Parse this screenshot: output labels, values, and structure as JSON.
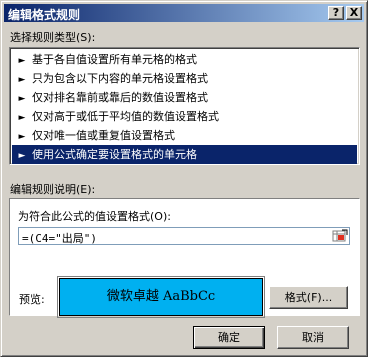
{
  "window": {
    "title": "编辑格式规则",
    "help_label": "?",
    "close_label": "X"
  },
  "rule_type": {
    "label": "选择规则类型(S):",
    "items": [
      {
        "label": "基于各自值设置所有单元格的格式"
      },
      {
        "label": "只为包含以下内容的单元格设置格式"
      },
      {
        "label": "仅对排名靠前或靠后的数值设置格式"
      },
      {
        "label": "仅对高于或低于平均值的数值设置格式"
      },
      {
        "label": "仅对唯一值或重复值设置格式"
      },
      {
        "label": "使用公式确定要设置格式的单元格"
      }
    ],
    "selected_index": 5,
    "arrow_glyph": "►"
  },
  "description": {
    "label": "编辑规则说明(E):",
    "formula_label": "为符合此公式的值设置格式(O):",
    "formula_value": "=(C4=\"出局\")",
    "preview_label": "预览:",
    "preview_text": "微软卓越  AaBbCc",
    "preview_bg": "#00b0f0",
    "format_button": "格式(F)..."
  },
  "footer": {
    "ok_label": "确定",
    "cancel_label": "取消"
  },
  "colors": {
    "selection": "#0a246a",
    "face": "#d4d0c8"
  }
}
